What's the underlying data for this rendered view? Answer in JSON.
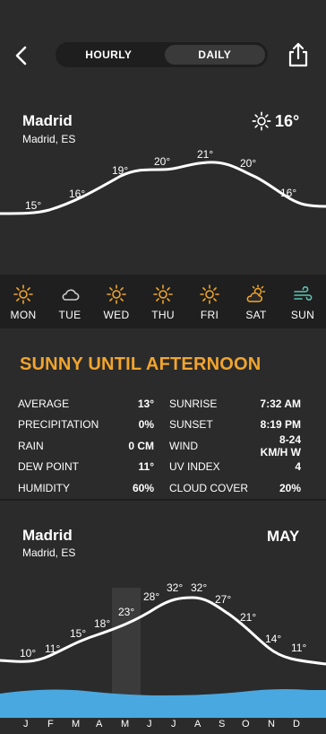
{
  "header": {
    "tabs": [
      {
        "label": "HOURLY",
        "active": true
      },
      {
        "label": "DAILY",
        "active": false
      }
    ]
  },
  "current": {
    "city": "Madrid",
    "region": "Madrid, ES",
    "temp": "16°"
  },
  "hourly_temps": [
    "15°",
    "16°",
    "19°",
    "20°",
    "21°",
    "20°",
    "16°"
  ],
  "week": [
    {
      "day": "MON",
      "icon": "sun-icon"
    },
    {
      "day": "TUE",
      "icon": "cloud-icon"
    },
    {
      "day": "WED",
      "icon": "sun-icon"
    },
    {
      "day": "THU",
      "icon": "sun-icon"
    },
    {
      "day": "FRI",
      "icon": "sun-icon"
    },
    {
      "day": "SAT",
      "icon": "partly-cloudy-icon"
    },
    {
      "day": "SUN",
      "icon": "wind-icon"
    }
  ],
  "summary": "SUNNY UNTIL AFTERNOON",
  "stats": [
    {
      "k1": "AVERAGE",
      "v1": "13°",
      "k2": "SUNRISE",
      "v2": "7:32 AM"
    },
    {
      "k1": "PRECIPITATION",
      "v1": "0%",
      "k2": "SUNSET",
      "v2": "8:19 PM"
    },
    {
      "k1": "RAIN",
      "v1": "0 CM",
      "k2": "WIND",
      "v2": "8-24 KM/H W"
    },
    {
      "k1": "DEW POINT",
      "v1": "11°",
      "k2": "UV INDEX",
      "v2": "4"
    },
    {
      "k1": "HUMIDITY",
      "v1": "60%",
      "k2": "CLOUD COVER",
      "v2": "20%"
    }
  ],
  "yearly": {
    "city": "Madrid",
    "region": "Madrid, ES",
    "month": "MAY",
    "temps": [
      "10°",
      "11°",
      "15°",
      "18°",
      "23°",
      "28°",
      "32°",
      "32°",
      "27°",
      "21°",
      "14°",
      "11°"
    ],
    "months": [
      "J",
      "F",
      "M",
      "A",
      "M",
      "J",
      "J",
      "A",
      "S",
      "O",
      "N",
      "D"
    ]
  },
  "colors": {
    "accent": "#f1a52e",
    "rain": "#4aa8e0",
    "wind": "#5fc4b4"
  }
}
